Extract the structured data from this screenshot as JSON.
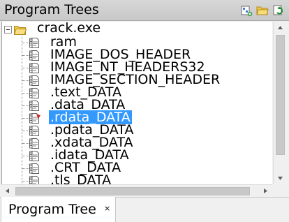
{
  "panel": {
    "title": "Program Trees",
    "actions": [
      "new-tree-icon",
      "open-folder-icon",
      "refresh-icon"
    ]
  },
  "tree": {
    "root": {
      "label": "crack.exe",
      "icon": "folder-icon",
      "expanded": true
    },
    "items": [
      {
        "label": "ram",
        "icon": "document-icon"
      },
      {
        "label": "IMAGE_DOS_HEADER",
        "icon": "document-icon"
      },
      {
        "label": "IMAGE_NT_HEADERS32",
        "icon": "document-icon"
      },
      {
        "label": "IMAGE_SECTION_HEADER",
        "icon": "document-icon"
      },
      {
        "label": ".text_DATA",
        "icon": "document-icon"
      },
      {
        "label": ".data_DATA",
        "icon": "document-icon"
      },
      {
        "label": ".rdata_DATA",
        "icon": "document-marked-icon",
        "selected": true
      },
      {
        "label": ".pdata_DATA",
        "icon": "document-icon"
      },
      {
        "label": ".xdata_DATA",
        "icon": "document-icon"
      },
      {
        "label": ".idata_DATA",
        "icon": "document-icon"
      },
      {
        "label": ".CRT_DATA",
        "icon": "document-icon"
      },
      {
        "label": ".tls_DATA",
        "icon": "document-icon"
      }
    ]
  },
  "tabs": [
    {
      "label": "Program Tree",
      "close": "×",
      "active": true
    }
  ],
  "colors": {
    "selection": "#3399ff",
    "titlebar": "#d0d0d0",
    "background": "#f0f0f0"
  }
}
